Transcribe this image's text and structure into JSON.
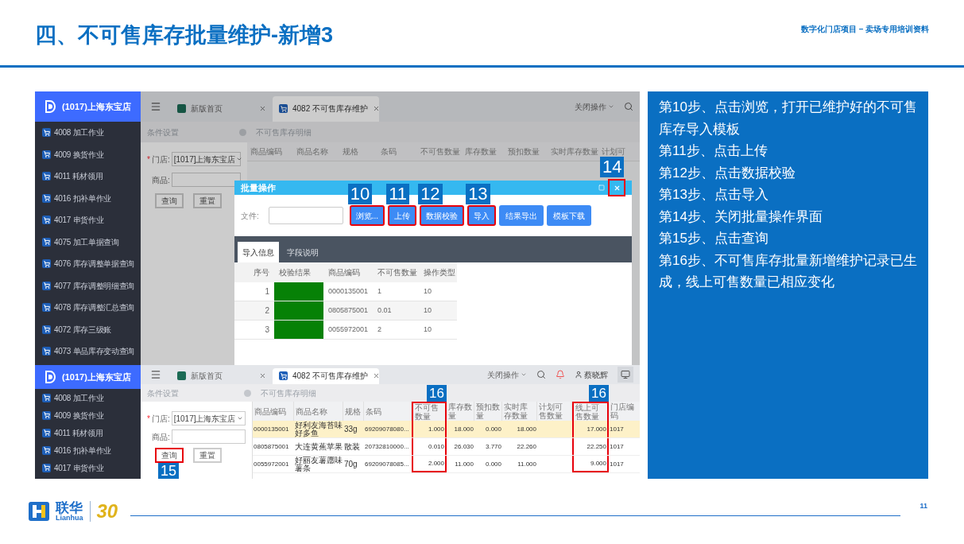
{
  "header": {
    "title": "四、不可售库存批量维护-新增3",
    "subtitle": "数字化门店项目 – 卖场专用培训资料"
  },
  "upper": {
    "store": "(1017)上海东宝店",
    "menu": [
      "4008 加工作业",
      "4009 换货作业",
      "4011 耗材领用",
      "4016 扣补单作业",
      "4017 串货作业",
      "4075 加工单据查询",
      "4076 库存调整单据查询",
      "4077 库存调整明细查询",
      "4078 库存调整汇总查询",
      "4072 库存三级账",
      "4073 单品库存变动查询"
    ],
    "tabs": [
      {
        "label": "新版首页",
        "selected": false
      },
      {
        "label": "4082 不可售库存维护",
        "selected": true
      }
    ],
    "close_ops": "关闭操作",
    "left_bar": "条件设置",
    "right_bar": "不可售库存明细",
    "form": {
      "required_mark": "*",
      "store_label": "门店:",
      "store_value": "[1017]上海东宝店",
      "product_label": "商品:",
      "buttons": [
        {
          "label": "查询"
        },
        {
          "label": "重置"
        }
      ]
    },
    "columns": [
      "商品编码",
      "商品名称",
      "规格",
      "条码",
      "不可售数量",
      "库存数量",
      "预扣数量",
      "实时库存数量",
      "计划可"
    ],
    "dialog": {
      "title": "批量操作",
      "close_callout": "14",
      "file_label": "文件:",
      "buttons": [
        {
          "label": "浏览...",
          "callout": "10"
        },
        {
          "label": "上传",
          "callout": "11"
        },
        {
          "label": "数据校验",
          "callout": "12"
        },
        {
          "label": "导入",
          "callout": "13"
        },
        {
          "label": "结果导出"
        },
        {
          "label": "模板下载"
        }
      ],
      "tabs": [
        {
          "label": "导入信息",
          "selected": true
        },
        {
          "label": "字段说明",
          "selected": false
        }
      ],
      "columns": [
        "序号",
        "校验结果",
        "商品编码",
        "不可售数量",
        "操作类型"
      ],
      "rows": [
        {
          "no": "1",
          "valid": true,
          "code": "0000135001",
          "qty": "1",
          "type": "10"
        },
        {
          "no": "2",
          "valid": true,
          "code": "0805875001",
          "qty": "0.01",
          "type": "10"
        },
        {
          "no": "3",
          "valid": true,
          "code": "0055972001",
          "qty": "2",
          "type": "10"
        }
      ]
    }
  },
  "lower": {
    "store": "(1017)上海东宝店",
    "menu": [
      "4008 加工作业",
      "4009 换货作业",
      "4011 耗材领用",
      "4016 扣补单作业",
      "4017 串货作业"
    ],
    "tabs": [
      {
        "label": "新版首页",
        "selected": false
      },
      {
        "label": "4082 不可售库存维护",
        "selected": true
      }
    ],
    "close_ops": "关闭操作",
    "user": "蔡晓辉",
    "left_bar": "条件设置",
    "right_bar": "不可售库存明细",
    "form": {
      "required_mark": "*",
      "store_label": "门店:",
      "store_value": "[1017]上海东宝店",
      "product_label": "商品:",
      "buttons": [
        {
          "label": "查询",
          "callout": "15"
        },
        {
          "label": "重置"
        }
      ]
    },
    "columns": [
      {
        "label": "商品编码"
      },
      {
        "label": "商品名称"
      },
      {
        "label": "规格"
      },
      {
        "label": "条码"
      },
      {
        "label": "不可售数量",
        "callout": "16"
      },
      {
        "label": "库存数量"
      },
      {
        "label": "预扣数量"
      },
      {
        "label": "实时库存数量"
      },
      {
        "label": "计划可售数量"
      },
      {
        "label": "线上可售数量",
        "callout": "16"
      },
      {
        "label": "门店编码"
      }
    ],
    "rows": [
      {
        "selected": true,
        "cells": [
          "0000135001",
          "好利友海苔味好多鱼",
          "33g",
          "69209078080...",
          "1.000",
          "18.000",
          "0.000",
          "18.000",
          "",
          "17.000",
          "1017"
        ]
      },
      {
        "selected": false,
        "cells": [
          "0805875001",
          "大连黄蕉苹果",
          "散装",
          "20732810000...",
          "0.010",
          "26.030",
          "3.770",
          "22.260",
          "",
          "22.250",
          "1017"
        ]
      },
      {
        "selected": false,
        "cells": [
          "0055972001",
          "好丽友薯愿味薯条",
          "70g",
          "69209078085...",
          "2.000",
          "11.000",
          "0.000",
          "11.000",
          "",
          "9.000",
          "1017"
        ]
      }
    ]
  },
  "steps": [
    "第10步、点击浏览，打开已维护好的不可售库存导入模板",
    "第11步、点击上传",
    "第12步、点击数据校验",
    "第13步、点击导入",
    "第14步、关闭批量操作界面",
    "第15步、点击查询",
    "第16步、不可售库存批量新增维护记录已生成，线上可售数量已相应变化"
  ],
  "footer": {
    "brand": "联华",
    "brand_latin": "Lianhua",
    "anniversary": "30",
    "page": "11"
  }
}
